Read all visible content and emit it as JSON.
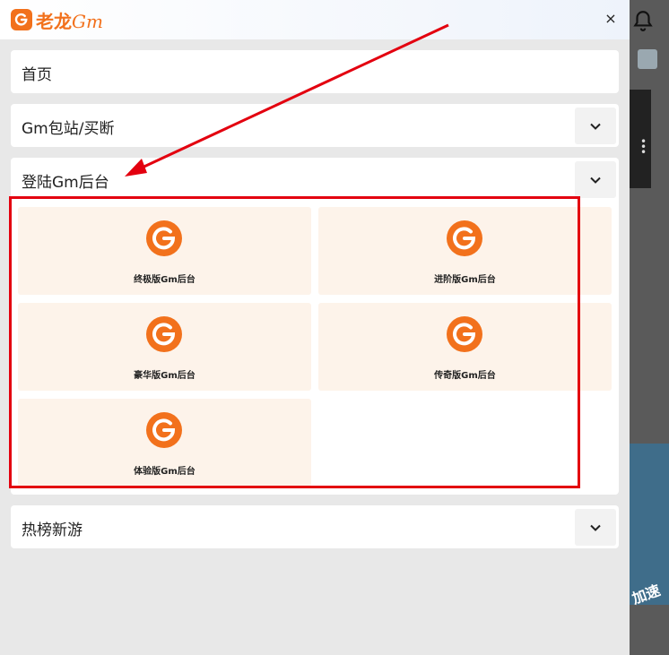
{
  "header": {
    "logo_text": "老龙",
    "logo_gm": "Gm",
    "close_label": "×"
  },
  "menu": {
    "home": "首页",
    "buyout": "Gm包站/买断",
    "login_backend": "登陆Gm后台",
    "hot_games": "热榜新游"
  },
  "backends": [
    {
      "label": "终极版Gm后台"
    },
    {
      "label": "进阶版Gm后台"
    },
    {
      "label": "豪华版Gm后台"
    },
    {
      "label": "传奇版Gm后台"
    },
    {
      "label": "体验版Gm后台"
    }
  ],
  "background_page": {
    "side_text": "加速"
  },
  "colors": {
    "brand": "#f2711c",
    "item_bg": "#fdf3ea",
    "highlight": "#e3000f"
  }
}
